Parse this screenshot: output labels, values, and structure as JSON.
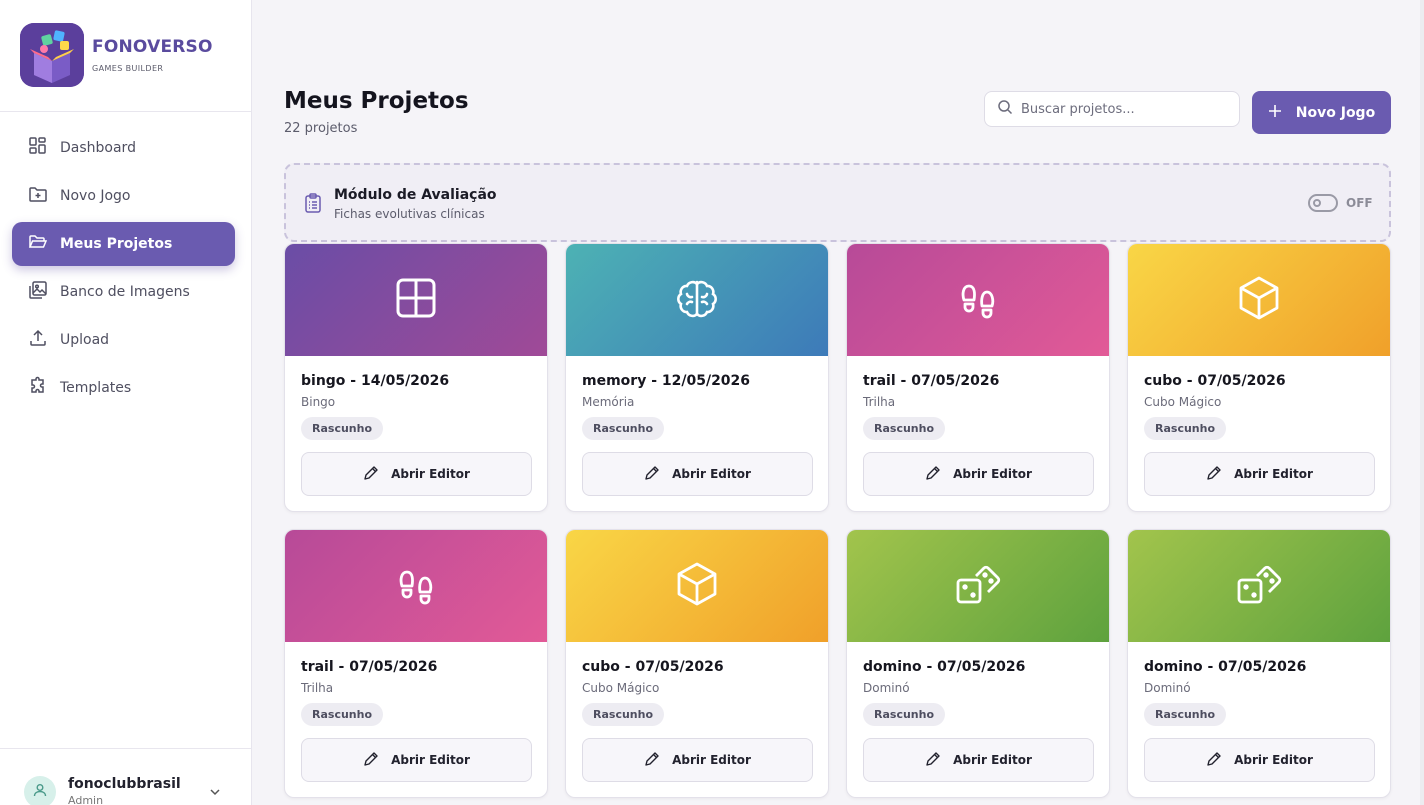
{
  "brand": {
    "title": "FONOVERSO",
    "subtitle": "GAMES BUILDER"
  },
  "sidebar": {
    "items": [
      {
        "label": "Dashboard",
        "icon": "dashboard-icon",
        "active": false
      },
      {
        "label": "Novo Jogo",
        "icon": "folder-plus-icon",
        "active": false
      },
      {
        "label": "Meus Projetos",
        "icon": "folder-open-icon",
        "active": true
      },
      {
        "label": "Banco de Imagens",
        "icon": "images-icon",
        "active": false
      },
      {
        "label": "Upload",
        "icon": "upload-icon",
        "active": false
      },
      {
        "label": "Templates",
        "icon": "puzzle-icon",
        "active": false
      }
    ]
  },
  "user": {
    "name": "fonoclubbrasil",
    "role": "Admin"
  },
  "header": {
    "title": "Meus Projetos",
    "count": "22 projetos"
  },
  "search": {
    "placeholder": "Buscar projetos...",
    "value": ""
  },
  "new_button": {
    "label": "Novo Jogo"
  },
  "module": {
    "title": "Módulo de Avaliação",
    "subtitle": "Fichas evolutivas clínicas",
    "toggle_label": "OFF",
    "enabled": false
  },
  "colors": {
    "accent": "#6a5bb0",
    "brand": "#5a4b9e"
  },
  "projects": [
    {
      "title": "bingo - 14/05/2026",
      "type": "Bingo",
      "status": "Rascunho",
      "action": "Abrir Editor",
      "icon": "grid-icon",
      "color": "purple"
    },
    {
      "title": "memory - 12/05/2026",
      "type": "Memória",
      "status": "Rascunho",
      "action": "Abrir Editor",
      "icon": "brain-icon",
      "color": "teal"
    },
    {
      "title": "trail - 07/05/2026",
      "type": "Trilha",
      "status": "Rascunho",
      "action": "Abrir Editor",
      "icon": "footprints-icon",
      "color": "pink"
    },
    {
      "title": "cubo - 07/05/2026",
      "type": "Cubo Mágico",
      "status": "Rascunho",
      "action": "Abrir Editor",
      "icon": "cube-icon",
      "color": "yellow"
    },
    {
      "title": "trail - 07/05/2026",
      "type": "Trilha",
      "status": "Rascunho",
      "action": "Abrir Editor",
      "icon": "footprints-icon",
      "color": "pink"
    },
    {
      "title": "cubo - 07/05/2026",
      "type": "Cubo Mágico",
      "status": "Rascunho",
      "action": "Abrir Editor",
      "icon": "cube-icon",
      "color": "yellow"
    },
    {
      "title": "domino - 07/05/2026",
      "type": "Dominó",
      "status": "Rascunho",
      "action": "Abrir Editor",
      "icon": "dice-icon",
      "color": "green"
    },
    {
      "title": "domino - 07/05/2026",
      "type": "Dominó",
      "status": "Rascunho",
      "action": "Abrir Editor",
      "icon": "dice-icon",
      "color": "green"
    }
  ]
}
